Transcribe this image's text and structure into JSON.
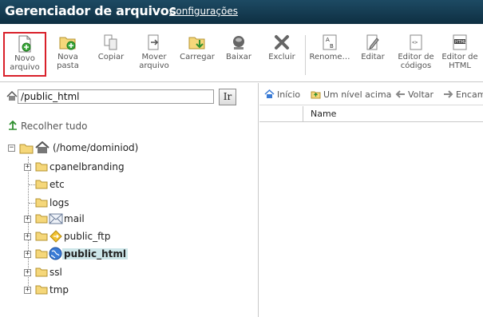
{
  "header": {
    "title": "Gerenciador de arquivos",
    "settings_link": "Configurações"
  },
  "toolbar": {
    "new_file": "Novo\narquivo",
    "new_folder": "Nova\npasta",
    "copy": "Copiar",
    "move": "Mover\narquivo",
    "upload": "Carregar",
    "download": "Baixar",
    "delete": "Excluir",
    "rename": "Renome…",
    "edit": "Editar",
    "code_editor": "Editor de\ncódigos",
    "html_editor": "Editor de\nHTML"
  },
  "path": {
    "value": "/public_html",
    "go_label": "Ir"
  },
  "collapse_all": "Recolher tudo",
  "tree": {
    "root": "(/home/dominiod)",
    "items": [
      "cpanelbranding",
      "etc",
      "logs",
      "mail",
      "public_ftp",
      "public_html",
      "ssl",
      "tmp"
    ]
  },
  "nav": {
    "home": "Início",
    "up_one": "Um nível acima",
    "back": "Voltar",
    "forward": "Encam"
  },
  "list": {
    "name_header": "Name"
  },
  "colors": {
    "header_bg": "#1d4a63",
    "selected_border": "#d9202a",
    "selected_row": "#cde6e9"
  }
}
